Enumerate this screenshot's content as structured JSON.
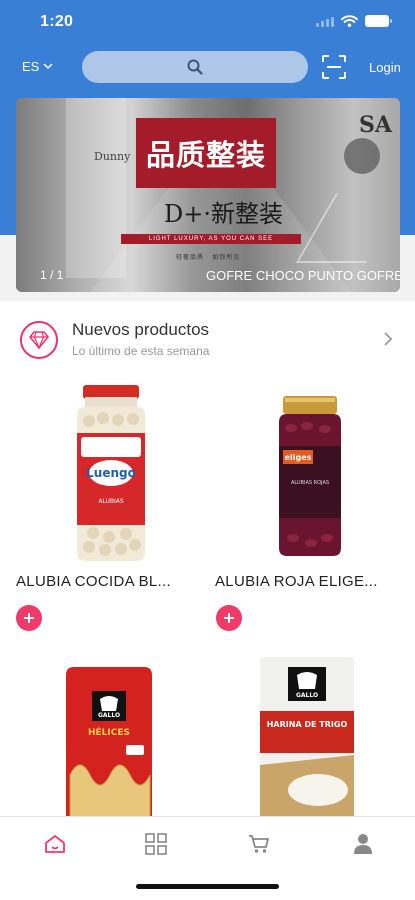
{
  "status": {
    "time": "1:20"
  },
  "header": {
    "language": "ES",
    "search": {
      "placeholder": "",
      "value": ""
    },
    "login_label": "Login",
    "accent_color": "#3a7fd6"
  },
  "banner": {
    "sign_text": "品质整装",
    "sub_text": "D+·新整装",
    "strip_text": "LIGHT LUXURY, AS YOU CAN SEE",
    "small_text": "轻奢品质 · 如你所见",
    "wall_text_left": "Dunny",
    "wall_text_right": "SA",
    "counter": "1 / 1",
    "caption": "GOFRE CHOCO PUNTO GOFRE"
  },
  "section": {
    "title": "Nuevos productos",
    "subtitle": "Lo último de esta semana",
    "badge_color": "#e8336b"
  },
  "products": [
    {
      "name": "ALUBIA COCIDA BL...",
      "brand": "Luengo",
      "label": "ALUBIAS"
    },
    {
      "name": "ALUBIA ROJA ELIGE...",
      "brand": "eliges",
      "label": "ALUBIAS ROJAS"
    },
    {
      "name": "",
      "brand": "GALLO",
      "label": "HÉLICES"
    },
    {
      "name": "",
      "brand": "GALLO",
      "label": "HARINA DE TRIGO"
    }
  ],
  "tabbar": {
    "items": [
      {
        "icon": "home-icon",
        "active": true
      },
      {
        "icon": "grid-icon",
        "active": false
      },
      {
        "icon": "cart-icon",
        "active": false
      },
      {
        "icon": "user-icon",
        "active": false
      }
    ],
    "active_color": "#ef3a6a"
  }
}
